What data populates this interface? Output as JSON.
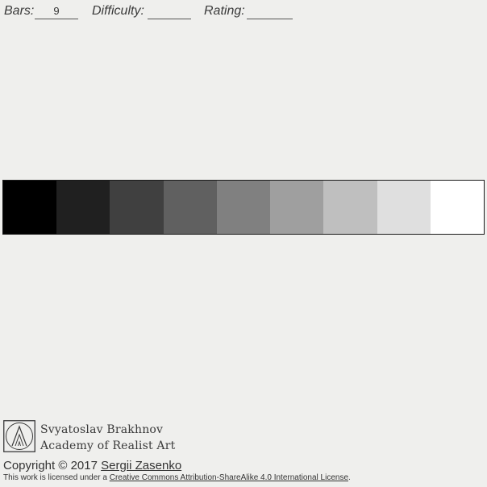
{
  "header": {
    "bars_label": "Bars:",
    "bars_value": "9",
    "difficulty_label": "Difficulty:",
    "difficulty_value": "",
    "rating_label": "Rating:",
    "rating_value": ""
  },
  "value_scale": {
    "swatches": [
      "#000000",
      "#202020",
      "#404040",
      "#606060",
      "#808080",
      "#9f9f9f",
      "#bfbfbf",
      "#dfdfdf",
      "#ffffff"
    ]
  },
  "footer": {
    "logo_icon": "academy-logo-icon",
    "academy_line1": "Svyatoslav Brakhnov",
    "academy_line2": "Academy of Realist Art",
    "copyright_prefix": "Copyright © 2017 ",
    "copyright_author": "Sergii Zasenko",
    "license_prefix": "This work is licensed under a ",
    "license_link": "Creative Commons Attribution-ShareAlike 4.0 International License",
    "license_suffix": "."
  }
}
